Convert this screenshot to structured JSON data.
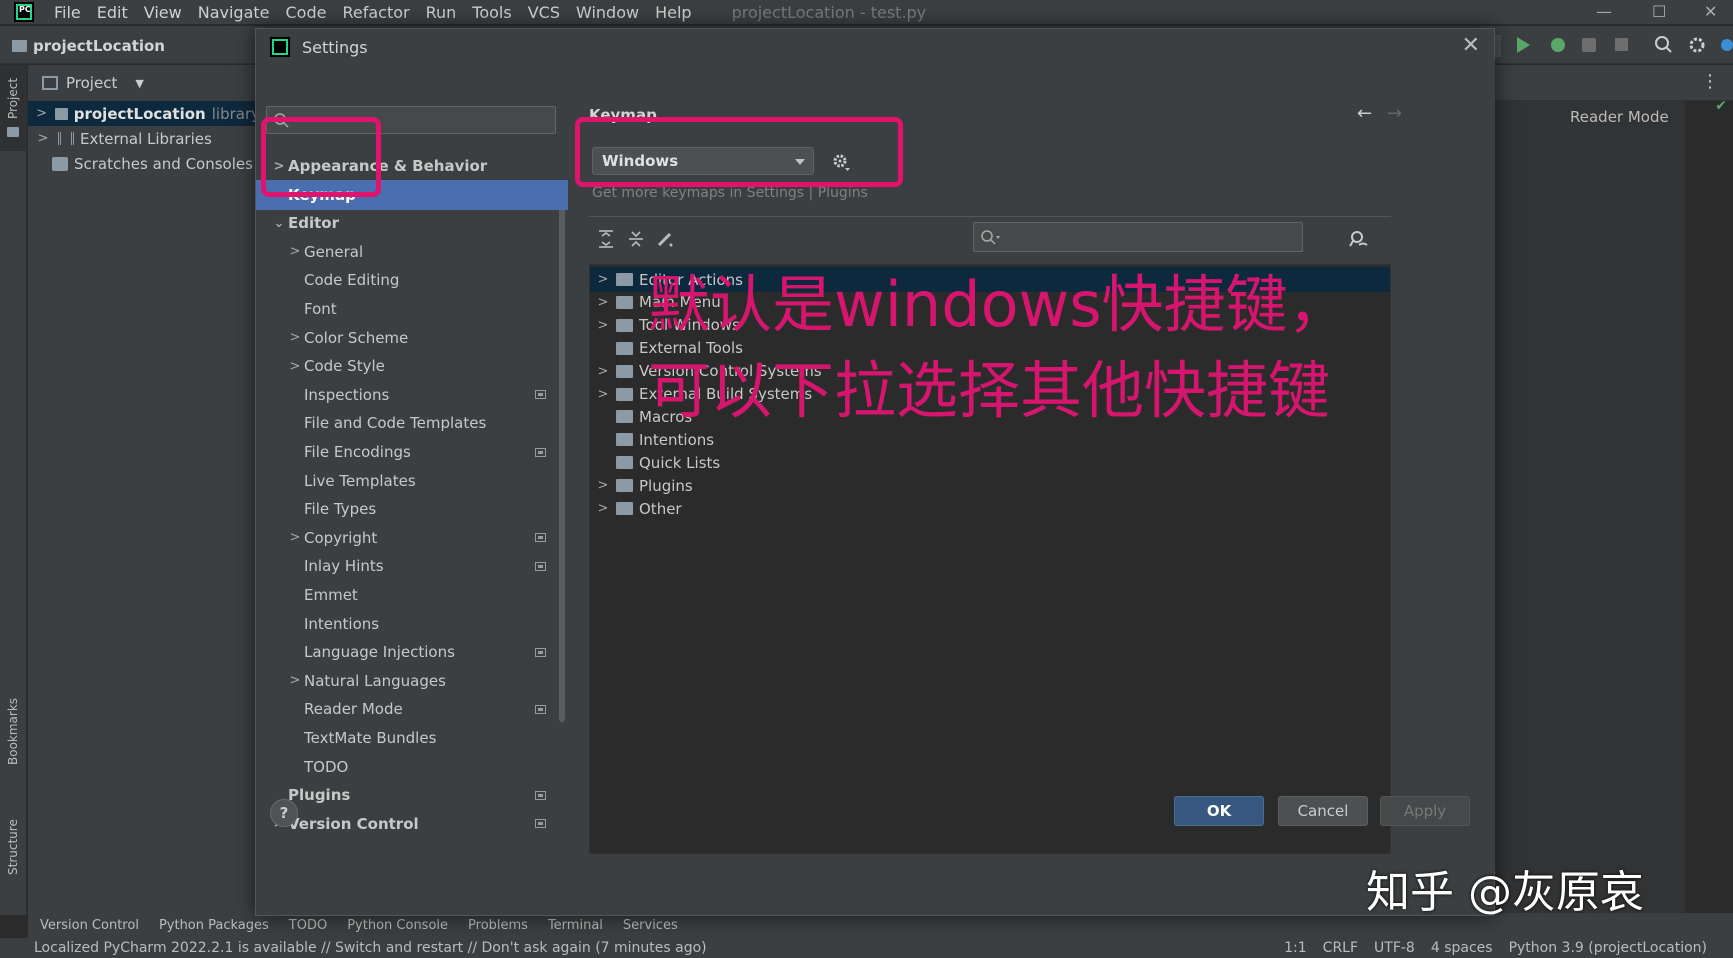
{
  "menubar": {
    "items": [
      "File",
      "Edit",
      "View",
      "Navigate",
      "Code",
      "Refactor",
      "Run",
      "Tools",
      "VCS",
      "Window",
      "Help"
    ],
    "window_title": "projectLocation - test.py"
  },
  "navbar": {
    "project": "projectLocation"
  },
  "project_panel": {
    "header": "Project",
    "tree": [
      {
        "label": "projectLocation",
        "suffix": "library"
      },
      {
        "label": "External Libraries"
      },
      {
        "label": "Scratches and Consoles"
      }
    ]
  },
  "left_stripe": {
    "project": "Project",
    "bookmarks": "Bookmarks",
    "structure": "Structure"
  },
  "editor": {
    "reader_mode": "Reader Mode"
  },
  "dialog": {
    "title": "Settings",
    "search_placeholder": "Q▾",
    "sidebar": [
      {
        "label": "Appearance & Behavior",
        "chevron": ">"
      },
      {
        "label": "Keymap",
        "selected": true
      },
      {
        "label": "Editor",
        "chevron": "⌄"
      },
      {
        "label": "General",
        "chevron": ">"
      },
      {
        "label": "Code Editing"
      },
      {
        "label": "Font"
      },
      {
        "label": "Color Scheme",
        "chevron": ">"
      },
      {
        "label": "Code Style",
        "chevron": ">"
      },
      {
        "label": "Inspections"
      },
      {
        "label": "File and Code Templates"
      },
      {
        "label": "File Encodings"
      },
      {
        "label": "Live Templates"
      },
      {
        "label": "File Types"
      },
      {
        "label": "Copyright",
        "chevron": ">"
      },
      {
        "label": "Inlay Hints"
      },
      {
        "label": "Emmet"
      },
      {
        "label": "Intentions"
      },
      {
        "label": "Language Injections"
      },
      {
        "label": "Natural Languages",
        "chevron": ">"
      },
      {
        "label": "Reader Mode"
      },
      {
        "label": "TextMate Bundles"
      },
      {
        "label": "TODO"
      },
      {
        "label": "Plugins"
      },
      {
        "label": "Version Control",
        "chevron": ">"
      }
    ],
    "keymap": {
      "title": "Keymap",
      "selected": "Windows",
      "hint": "Get more keymaps in Settings | Plugins",
      "actions": [
        {
          "label": "Editor Actions",
          "chevron": ">",
          "selected": true
        },
        {
          "label": "Main Menu",
          "chevron": ">"
        },
        {
          "label": "Tool Windows",
          "chevron": ">"
        },
        {
          "label": "External Tools"
        },
        {
          "label": "Version Control Systems",
          "chevron": ">"
        },
        {
          "label": "External Build Systems",
          "chevron": ">"
        },
        {
          "label": "Macros"
        },
        {
          "label": "Intentions"
        },
        {
          "label": "Quick Lists"
        },
        {
          "label": "Plugins",
          "chevron": ">"
        },
        {
          "label": "Other",
          "chevron": ">"
        }
      ]
    },
    "buttons": {
      "help": "?",
      "ok": "OK",
      "cancel": "Cancel",
      "apply": "Apply"
    }
  },
  "bottom_tabs": [
    "Version Control",
    "Python Packages",
    "TODO",
    "Python Console",
    "Problems",
    "Terminal",
    "Services"
  ],
  "statusbar": {
    "message": "Localized PyCharm 2022.2.1 is available // Switch and restart // Don't ask again (7 minutes ago)",
    "position": "1:1",
    "line_sep": "CRLF",
    "encoding": "UTF-8",
    "indent": "4 spaces",
    "interpreter": "Python 3.9 (projectLocation)"
  },
  "annotation": {
    "line1": "默认是windows快捷键，",
    "line2": "可以下拉选择其他快捷键",
    "color": "#e0136d"
  },
  "watermark": "知乎 @灰原哀"
}
